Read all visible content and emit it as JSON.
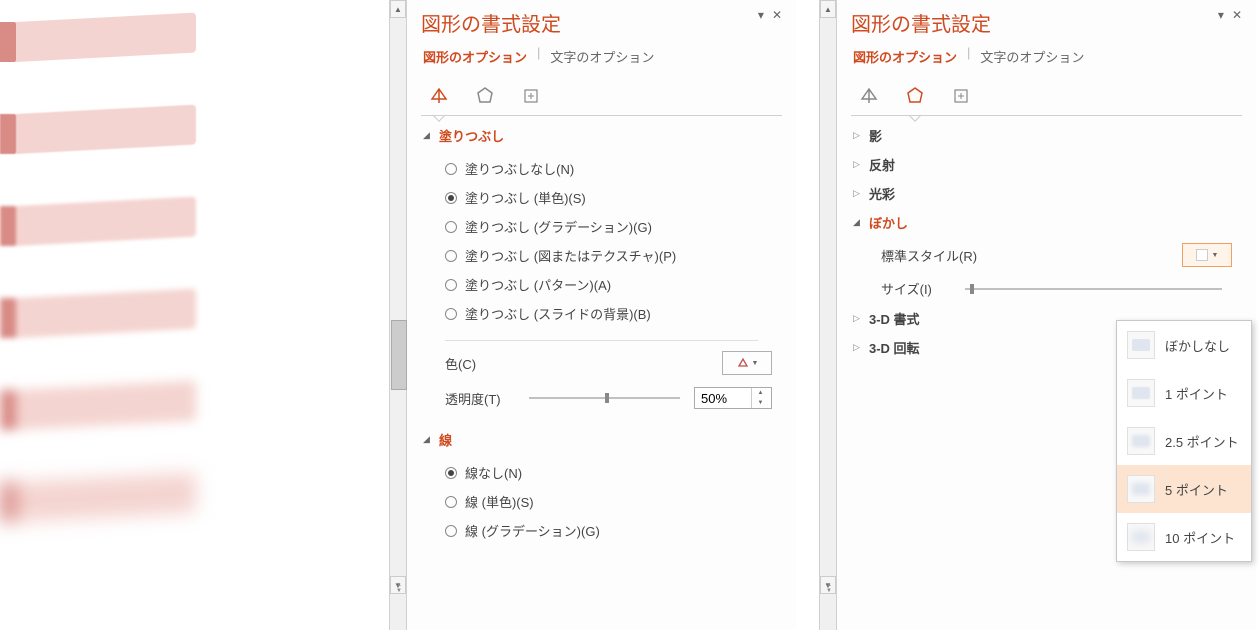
{
  "panel_title": "図形の書式設定",
  "tabs": {
    "shape": "図形のオプション",
    "text": "文字のオプション"
  },
  "left": {
    "fill_section": "塗りつぶし",
    "fill_options": {
      "none": "塗りつぶしなし(N)",
      "solid": "塗りつぶし (単色)(S)",
      "gradient": "塗りつぶし (グラデーション)(G)",
      "texture": "塗りつぶし (図またはテクスチャ)(P)",
      "pattern": "塗りつぶし (パターン)(A)",
      "slide_bg": "塗りつぶし (スライドの背景)(B)"
    },
    "color_label": "色(C)",
    "transparency_label": "透明度(T)",
    "transparency_value": "50%",
    "line_section": "線",
    "line_options": {
      "none": "線なし(N)",
      "solid": "線 (単色)(S)",
      "gradient": "線 (グラデーション)(G)"
    }
  },
  "right": {
    "sections": {
      "shadow": "影",
      "reflection": "反射",
      "glow": "光彩",
      "soft_edges": "ぼかし",
      "format_3d": "3-D 書式",
      "rotation_3d": "3-D 回転"
    },
    "preset_label": "標準スタイル(R)",
    "size_label": "サイズ(I)",
    "dropdown": {
      "none": "ぼかしなし",
      "p1": "1 ポイント",
      "p25": "2.5 ポイント",
      "p5": "5 ポイント",
      "p10": "10 ポイント"
    }
  }
}
